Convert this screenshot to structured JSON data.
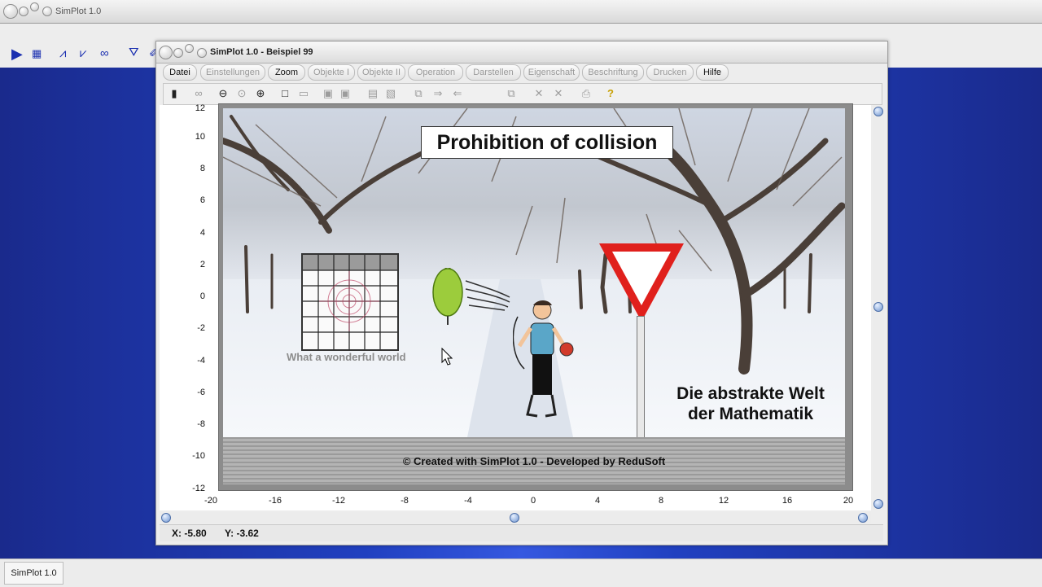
{
  "app": {
    "title": "SimPlot 1.0",
    "taskbar_label": "SimPlot 1.0"
  },
  "outer_toolbar": {
    "icons": [
      "play-icon",
      "data-table-icon",
      "line-graph-icon",
      "xy-graph-icon",
      "function-icon",
      "filter-icon"
    ]
  },
  "window": {
    "title": "SimPlot 1.0 - Beispiel 99",
    "menu": [
      {
        "label": "Datei",
        "enabled": true
      },
      {
        "label": "Einstellungen",
        "enabled": false
      },
      {
        "label": "Zoom",
        "enabled": true
      },
      {
        "label": "Objekte I",
        "enabled": false
      },
      {
        "label": "Objekte II",
        "enabled": false
      },
      {
        "label": "Operation",
        "enabled": false
      },
      {
        "label": "Darstellen",
        "enabled": false
      },
      {
        "label": "Eigenschaft",
        "enabled": false
      },
      {
        "label": "Beschriftung",
        "enabled": false
      },
      {
        "label": "Drucken",
        "enabled": false
      },
      {
        "label": "Hilfe",
        "enabled": true
      }
    ]
  },
  "axes": {
    "y_ticks": [
      "12",
      "10",
      "8",
      "6",
      "4",
      "2",
      "0",
      "-2",
      "-4",
      "-6",
      "-8",
      "-10",
      "-12"
    ],
    "x_ticks": [
      "-20",
      "-16",
      "-12",
      "-8",
      "-4",
      "0",
      "4",
      "8",
      "12",
      "16",
      "20"
    ]
  },
  "scene": {
    "title": "Prohibition of collision",
    "tagline": "What a wonderful world",
    "watermark_line1": "Die abstrakte Welt",
    "watermark_line2": "der Mathematik",
    "footer": "© Created with SimPlot 1.0 - Developed by ReduSoft"
  },
  "coordinates": {
    "x": "X:  -5.80",
    "y": "Y:  -3.62"
  },
  "colors": {
    "desktop": "#2040c0",
    "accent": "#1a2fb0",
    "sign_red": "#e0201c",
    "balloon_green": "#9ccc3c"
  }
}
